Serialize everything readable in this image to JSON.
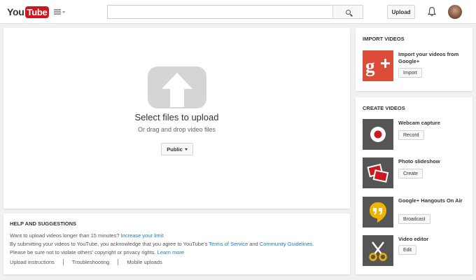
{
  "header": {
    "logo_you": "You",
    "logo_tube": "Tube",
    "search_placeholder": "",
    "upload_label": "Upload"
  },
  "upload": {
    "title": "Select files to upload",
    "subtitle": "Or drag and drop video files",
    "privacy_label": "Public"
  },
  "help": {
    "heading": "HELP AND SUGGESTIONS",
    "line1_text": "Want to upload videos longer than 15 minutes? ",
    "line1_link": "Increase your limit",
    "line2_text": "By submitting your videos to YouTube, you acknowledge that you agree to YouTube's ",
    "line2_link1": "Terms of Service",
    "line2_and": " and ",
    "line2_link2": "Community Guidelines",
    "line2_end": ".",
    "line3_text": "Please be sure not to violate others' copyright or privacy rights. ",
    "line3_link": "Learn more",
    "links": [
      "Upload instructions",
      "Troubleshooting",
      "Mobile uploads"
    ]
  },
  "import": {
    "heading": "IMPORT VIDEOS",
    "label": "Import your videos from Google+",
    "button": "Import"
  },
  "create": {
    "heading": "CREATE VIDEOS",
    "items": [
      {
        "label": "Webcam capture",
        "button": "Record"
      },
      {
        "label": "Photo slideshow",
        "button": "Create"
      },
      {
        "label": "Google+ Hangouts On Air",
        "button": "Broadcast"
      },
      {
        "label": "Video editor",
        "button": "Edit"
      }
    ]
  },
  "colors": {
    "brand_red": "#cc181e",
    "link_blue": "#167ac6",
    "gplus_red": "#dd4b39",
    "hangouts_yellow": "#f0b400"
  },
  "icons": [
    "guide-menu-icon",
    "search-icon",
    "bell-icon",
    "upload-arrow-icon",
    "google-plus-icon",
    "webcam-record-icon",
    "photo-slideshow-icon",
    "hangouts-icon",
    "video-editor-scissors-icon"
  ]
}
